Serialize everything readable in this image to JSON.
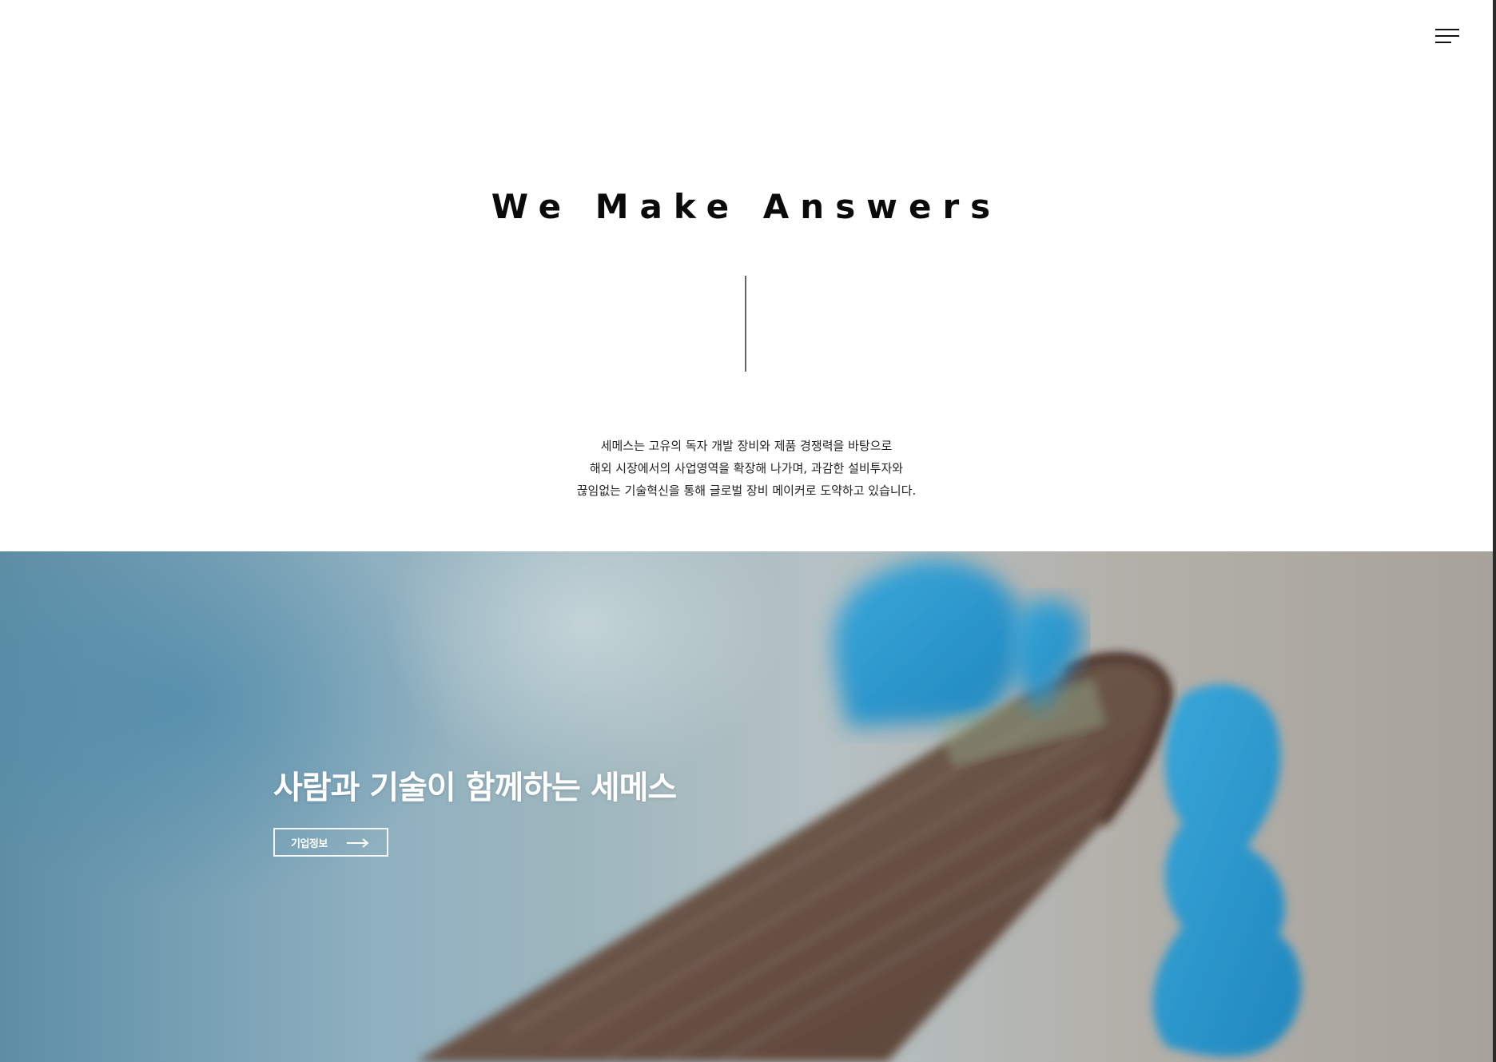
{
  "header": {
    "menu_icon": "hamburger-menu-icon"
  },
  "intro": {
    "title": "We Make Answers",
    "lines": [
      "세메스는 고유의 독자 개발 장비와 제품 경쟁력을 바탕으로",
      "해외 시장에서의 사업영역을 확장해 나가며, 과감한 설비투자와",
      "끊임없는 기술혁신을 통해 글로벌 장비 메이커로 도약하고 있습니다."
    ]
  },
  "hero": {
    "title": "사람과 기술이 함께하는 세메스",
    "button_label": "기업정보",
    "button_icon": "arrow-right-icon",
    "image_description": "gloved hand holding a semiconductor wafer"
  },
  "colors": {
    "text_dark": "#0a0a0a",
    "hero_text": "#ffffff",
    "glove_blue": "#2f9fd4"
  }
}
